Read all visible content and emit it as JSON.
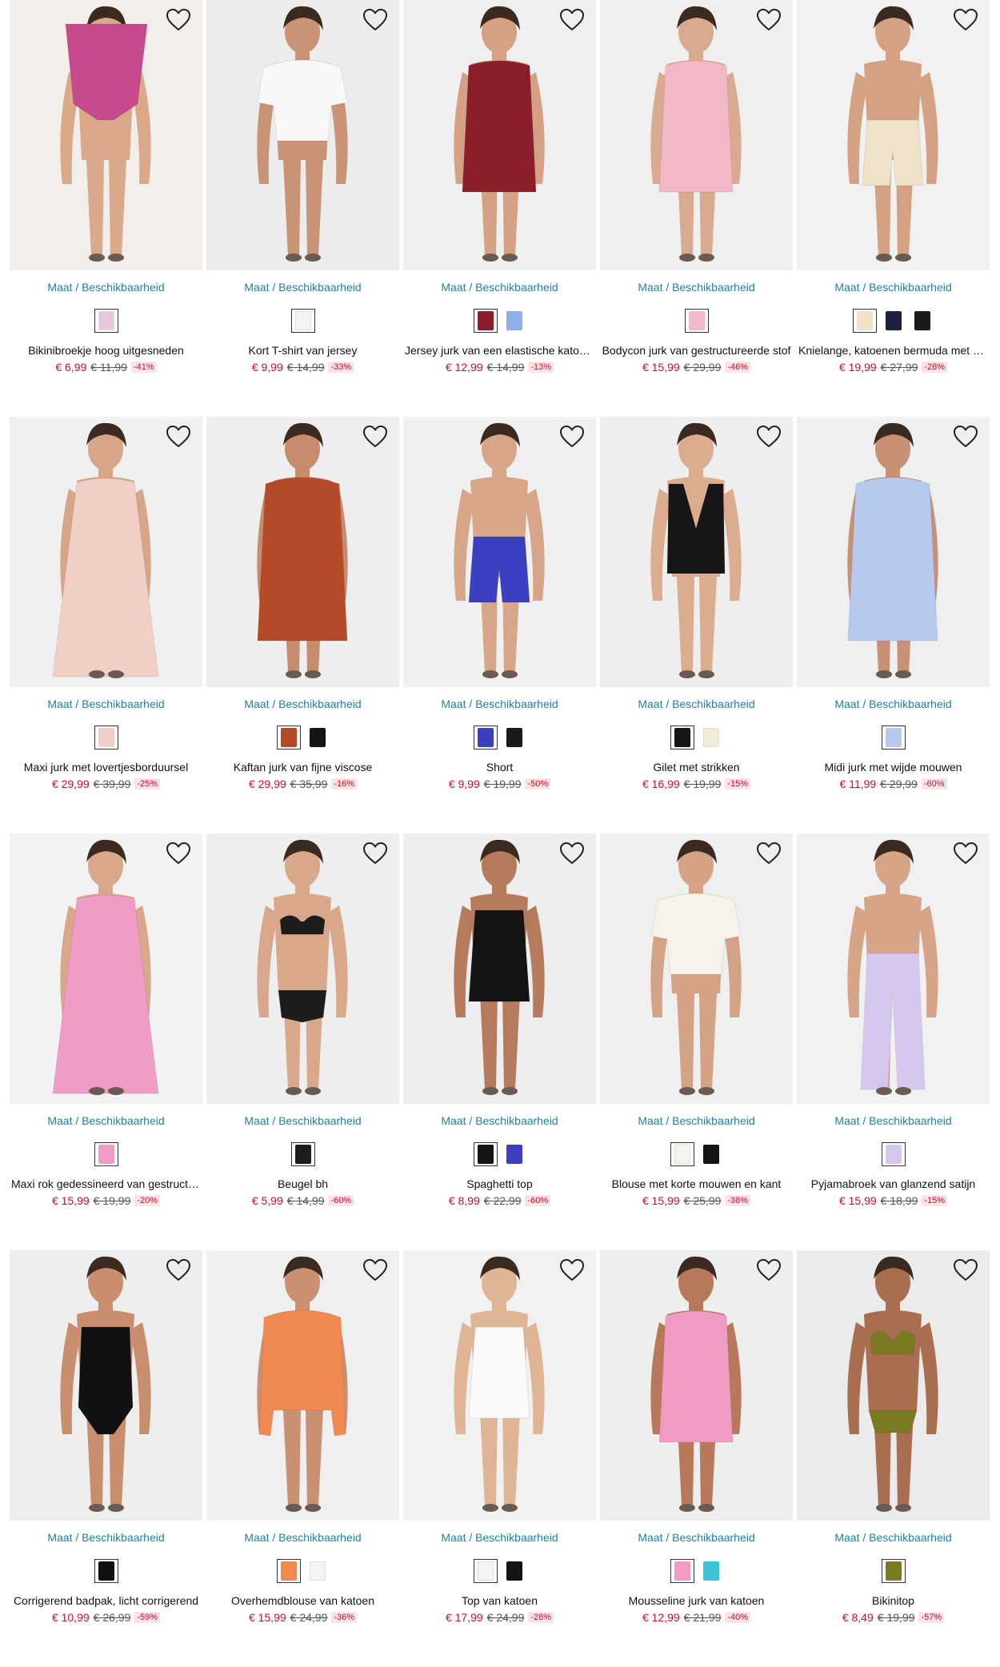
{
  "colors": {
    "link": "#1f7fa8",
    "price": "#c8102e",
    "badge_bg": "#fbe3e6"
  },
  "products": [
    {
      "size_link": "Maat / Beschikbaarheid",
      "name": "Bikinibroekje hoog uitgesneden",
      "price": "€ 6,99",
      "old_price": "€ 11,99",
      "discount": "-41%",
      "photo_bg": "#f2eeec",
      "garment": "#c84a8c",
      "skin": "#d9a98a",
      "shape": "bikini-bottom",
      "swatches": [
        "#e8c7de"
      ]
    },
    {
      "size_link": "Maat / Beschikbaarheid",
      "name": "Kort T-shirt van jersey",
      "price": "€ 9,99",
      "old_price": "€ 14,99",
      "discount": "-33%",
      "photo_bg": "#ececec",
      "garment": "#f8f8f8",
      "skin": "#c99376",
      "shape": "tee",
      "swatches": [
        "#f4f4f4"
      ]
    },
    {
      "size_link": "Maat / Beschikbaarheid",
      "name": "Jersey jurk van een elastische katoenmix",
      "price": "€ 12,99",
      "old_price": "€ 14,99",
      "discount": "-13%",
      "photo_bg": "#efefef",
      "garment": "#8c1e2c",
      "skin": "#d5a184",
      "shape": "dress-short",
      "swatches": [
        "#8c1e2c",
        "#8fb0e6"
      ]
    },
    {
      "size_link": "Maat / Beschikbaarheid",
      "name": "Bodycon jurk van gestructureerde stof",
      "price": "€ 15,99",
      "old_price": "€ 29,99",
      "discount": "-46%",
      "photo_bg": "#efefef",
      "garment": "#f2b8c6",
      "skin": "#d9aa8f",
      "shape": "dress-short",
      "swatches": [
        "#f2b8c6"
      ]
    },
    {
      "size_link": "Maat / Beschikbaarheid",
      "name": "Knielange, katoenen bermuda met steekzakken",
      "price": "€ 19,99",
      "old_price": "€ 27,99",
      "discount": "-28%",
      "photo_bg": "#f1f1f1",
      "garment": "#efe2c8",
      "skin": "#d4a282",
      "shape": "shorts",
      "swatches": [
        "#efe2c8",
        "#1c2140",
        "#1b1b1b"
      ]
    },
    {
      "size_link": "Maat / Beschikbaarheid",
      "name": "Maxi jurk met lovertjesborduursel",
      "price": "€ 29,99",
      "old_price": "€ 39,99",
      "discount": "-25%",
      "photo_bg": "#efefef",
      "garment": "#f1cfc6",
      "skin": "#d7a689",
      "shape": "maxi",
      "swatches": [
        "#f1cfc6"
      ]
    },
    {
      "size_link": "Maat / Beschikbaarheid",
      "name": "Kaftan jurk van fijne viscose",
      "price": "€ 29,99",
      "old_price": "€ 35,99",
      "discount": "-16%",
      "photo_bg": "#eeeeee",
      "garment": "#b44a28",
      "skin": "#c68c6c",
      "shape": "dress-midi",
      "swatches": [
        "#b44a28",
        "#151515"
      ]
    },
    {
      "size_link": "Maat / Beschikbaarheid",
      "name": "Short",
      "price": "€ 9,99",
      "old_price": "€ 19,99",
      "discount": "-50%",
      "photo_bg": "#f0f0f0",
      "garment": "#3b3fc0",
      "skin": "#d7a688",
      "shape": "shorts",
      "swatches": [
        "#3b3fc0",
        "#1a1a1a"
      ]
    },
    {
      "size_link": "Maat / Beschikbaarheid",
      "name": "Gilet met strikken",
      "price": "€ 16,99",
      "old_price": "€ 19,99",
      "discount": "-15%",
      "photo_bg": "#eeeeee",
      "garment": "#161616",
      "skin": "#dcac8e",
      "shape": "vest",
      "swatches": [
        "#161616",
        "#f3ecd9"
      ]
    },
    {
      "size_link": "Maat / Beschikbaarheid",
      "name": "Midi jurk met wijde mouwen",
      "price": "€ 11,99",
      "old_price": "€ 29,99",
      "discount": "-60%",
      "photo_bg": "#efefef",
      "garment": "#b7c9ef",
      "skin": "#c89173",
      "shape": "dress-midi",
      "swatches": [
        "#b7c9ef"
      ]
    },
    {
      "size_link": "Maat / Beschikbaarheid",
      "name": "Maxi rok gedessineerd van gestructureerde stof",
      "price": "€ 15,99",
      "old_price": "€ 19,99",
      "discount": "-20%",
      "photo_bg": "#f2f2f2",
      "garment": "#ef9cc6",
      "skin": "#d9a88a",
      "shape": "maxi",
      "swatches": [
        "#ef9cc6"
      ]
    },
    {
      "size_link": "Maat / Beschikbaarheid",
      "name": "Beugel bh",
      "price": "€ 5,99",
      "old_price": "€ 14,99",
      "discount": "-60%",
      "photo_bg": "#eeeeee",
      "garment": "#1d1d1d",
      "skin": "#d9a88a",
      "shape": "lingerie",
      "swatches": [
        "#1d1d1d"
      ]
    },
    {
      "size_link": "Maat / Beschikbaarheid",
      "name": "Spaghetti top",
      "price": "€ 8,99",
      "old_price": "€ 22,99",
      "discount": "-60%",
      "photo_bg": "#eeeeee",
      "garment": "#141414",
      "skin": "#b57b5c",
      "shape": "cami",
      "swatches": [
        "#141414",
        "#3b3fc0"
      ]
    },
    {
      "size_link": "Maat / Beschikbaarheid",
      "name": "Blouse met korte mouwen en kant",
      "price": "€ 15,99",
      "old_price": "€ 25,99",
      "discount": "-38%",
      "photo_bg": "#efefef",
      "garment": "#f7f3ea",
      "skin": "#d4a385",
      "shape": "tee",
      "swatches": [
        "#f7f3ea",
        "#141414"
      ]
    },
    {
      "size_link": "Maat / Beschikbaarheid",
      "name": "Pyjamabroek van glanzend satijn",
      "price": "€ 15,99",
      "old_price": "€ 18,99",
      "discount": "-15%",
      "photo_bg": "#f1f1f1",
      "garment": "#d6c7ee",
      "skin": "#d6a486",
      "shape": "trousers",
      "swatches": [
        "#d6c7ee"
      ]
    },
    {
      "size_link": "Maat / Beschikbaarheid",
      "name": "Corrigerend badpak, licht corrigerend",
      "price": "€ 10,99",
      "old_price": "€ 26,99",
      "discount": "-59%",
      "photo_bg": "#eeeeee",
      "garment": "#111111",
      "skin": "#c98e6e",
      "shape": "swimsuit",
      "swatches": [
        "#111111"
      ]
    },
    {
      "size_link": "Maat / Beschikbaarheid",
      "name": "Overhemdblouse van katoen",
      "price": "€ 15,99",
      "old_price": "€ 24,99",
      "discount": "-36%",
      "photo_bg": "#efefef",
      "garment": "#f08a52",
      "skin": "#c99072",
      "shape": "shirt",
      "swatches": [
        "#f08a52",
        "#f4f4f4"
      ]
    },
    {
      "size_link": "Maat / Beschikbaarheid",
      "name": "Top van katoen",
      "price": "€ 17,99",
      "old_price": "€ 24,99",
      "discount": "-28%",
      "photo_bg": "#f1f1f1",
      "garment": "#fafafa",
      "skin": "#e0b596",
      "shape": "cami",
      "swatches": [
        "#f4f4f4",
        "#141414"
      ]
    },
    {
      "size_link": "Maat / Beschikbaarheid",
      "name": "Mousseline jurk van katoen",
      "price": "€ 12,99",
      "old_price": "€ 21,99",
      "discount": "-40%",
      "photo_bg": "#eeeeee",
      "garment": "#f19ac4",
      "skin": "#b8795a",
      "shape": "dress-short",
      "swatches": [
        "#f19ac4",
        "#3ac4d6"
      ]
    },
    {
      "size_link": "Maat / Beschikbaarheid",
      "name": "Bikinitop",
      "price": "€ 8,49",
      "old_price": "€ 19,99",
      "discount": "-57%",
      "photo_bg": "#ebebeb",
      "garment": "#7a7a22",
      "skin": "#a96e4f",
      "shape": "bikini-top",
      "swatches": [
        "#7a7a22"
      ]
    }
  ]
}
